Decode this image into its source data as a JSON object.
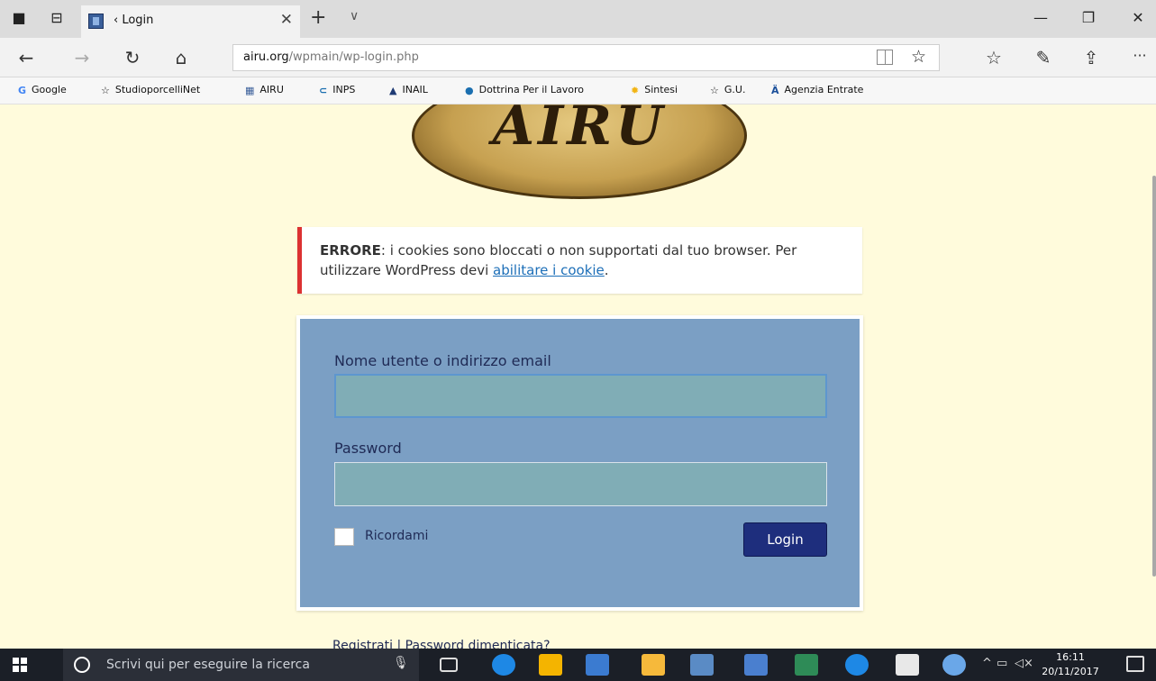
{
  "browser": {
    "tab_title": "‹ Login",
    "address_host": "airu.org",
    "address_path": "/wpmain/wp-login.php",
    "more_label": "···",
    "bookmarks": [
      "Google",
      "StudioporcelliNet",
      "AIRU",
      "INPS",
      "INAIL",
      "Dottrina Per il Lavoro",
      "Sintesi",
      "G.U.",
      "Agenzia Entrate"
    ]
  },
  "page": {
    "logo_text": "AIRU",
    "error_prefix": "ERRORE",
    "error_text_1": ": i cookies sono bloccati o non supportati dal tuo browser. Per utilizzare WordPress devi ",
    "error_link": "abilitare i cookie",
    "error_text_2": ".",
    "username_label": "Nome utente o indirizzo email",
    "password_label": "Password",
    "remember_label": "Ricordami",
    "login_button": "Login",
    "register_link": "Registrati",
    "separator": " | ",
    "forgot_link": "Password dimenticata?"
  },
  "taskbar": {
    "search_placeholder": "Scrivi qui per eseguire la ricerca",
    "time": "16:11",
    "date": "20/11/2017"
  },
  "colors": {
    "page_background": "#fffbdc",
    "error_border": "#dc3232",
    "login_panel": "#7b9fc4",
    "login_button": "#1e2e7d",
    "input_fill": "#80adb6"
  },
  "icons": [
    "tab-set-aside-icon",
    "tab-preview-icon",
    "back-icon",
    "forward-icon",
    "refresh-icon",
    "home-icon",
    "reading-view-icon",
    "favorite-star-icon",
    "favorites-hub-icon",
    "pen-icon",
    "share-icon",
    "more-icon"
  ]
}
